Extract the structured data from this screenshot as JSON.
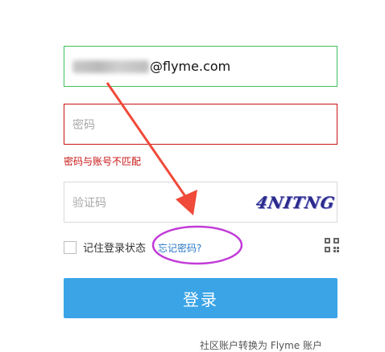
{
  "email_field": {
    "value_suffix": "@flyme.com"
  },
  "password_field": {
    "placeholder": "密码"
  },
  "error": {
    "message": "密码与账号不匹配"
  },
  "captcha_field": {
    "placeholder": "验证码",
    "image_text": "4NITNG"
  },
  "remember": {
    "label": "记住登录状态"
  },
  "forgot": {
    "label": "忘记密码?"
  },
  "login_button": {
    "label": "登录"
  },
  "footer": {
    "switch_label": "社区账户转换为 Flyme 账户"
  },
  "icons": {
    "qr": "qr-code-icon"
  },
  "colors": {
    "accent": "#3aa4e6",
    "error": "#c81414",
    "valid": "#3fbf5f",
    "annotation_arrow": "#f04a3a",
    "annotation_ellipse": "#c23bd8"
  }
}
